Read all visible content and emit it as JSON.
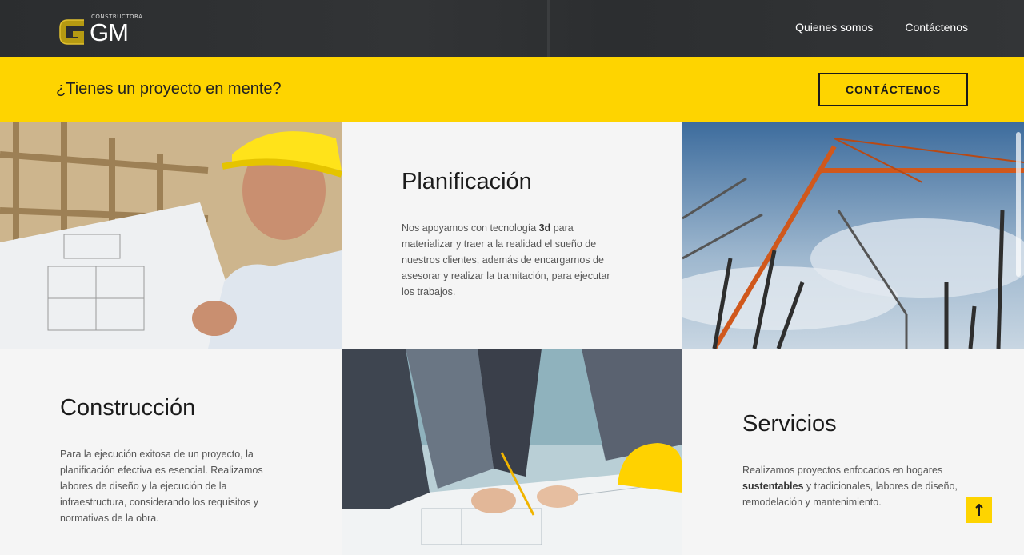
{
  "brand": {
    "small": "CONSTRUCTORA",
    "big": "GM"
  },
  "nav": {
    "about": "Quienes somos",
    "contact": "Contáctenos"
  },
  "cta": {
    "title": "¿Tienes un proyecto en mente?",
    "button": "CONTÁCTENOS"
  },
  "planificacion": {
    "title": "Planificación",
    "p1": "Nos apoyamos con tecnología ",
    "bold": "3d",
    "p2": " para materializar y traer a la realidad el sueño de nuestros clientes, además de encargarnos de asesorar y realizar la tramitación, para ejecutar los trabajos."
  },
  "construccion": {
    "title": "Construcción",
    "text": "Para la ejecución exitosa de un proyecto, la planificación efectiva es esencial. Realizamos labores de diseño y la ejecución de la infraestructura, considerando los requisitos y normativas de la obra."
  },
  "servicios": {
    "title": "Servicios",
    "p1": "Realizamos proyectos enfocados en hogares ",
    "bold": "sustentables",
    "p2": " y tradicionales, labores de diseño, remodelación y mantenimiento."
  },
  "colors": {
    "accent": "#fed400",
    "header": "#2f3133"
  },
  "icons": {
    "to_top": "arrow-up-icon"
  }
}
